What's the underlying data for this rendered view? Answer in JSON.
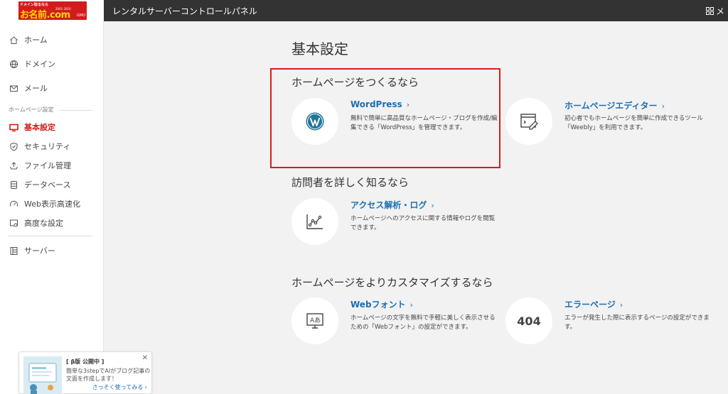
{
  "logo": {
    "tagline": "ドメイン取るなら",
    "main": "お名前.com",
    "sub": "GMO",
    "mini": "2001 2010"
  },
  "topbar": {
    "title": "レンタルサーバーコントロールパネル",
    "menu_label": "メ"
  },
  "sidebar": {
    "items": [
      {
        "label": "ホーム",
        "icon": "home-icon"
      },
      {
        "label": "ドメイン",
        "icon": "globe-icon"
      },
      {
        "label": "メール",
        "icon": "mail-icon"
      }
    ],
    "section_label": "ホームページ設定",
    "section_items": [
      {
        "label": "基本設定",
        "icon": "monitor-icon",
        "active": true
      },
      {
        "label": "セキュリティ",
        "icon": "shield-icon"
      },
      {
        "label": "ファイル管理",
        "icon": "upload-icon"
      },
      {
        "label": "データベース",
        "icon": "database-icon"
      },
      {
        "label": "Web表示高速化",
        "icon": "speed-icon"
      },
      {
        "label": "高度な設定",
        "icon": "advanced-settings-icon"
      }
    ],
    "server_item": {
      "label": "サーバー",
      "icon": "server-icon"
    }
  },
  "beta_card": {
    "title": "[ β版 公開中 ]",
    "desc": "簡単な3stepでAIがブログ記事の文面を作成します！",
    "link": "さっそく使ってみる ›",
    "close": "✕"
  },
  "main": {
    "title": "基本設定",
    "sections": [
      {
        "title": "ホームページをつくるなら",
        "cards": [
          {
            "title": "WordPress",
            "chev": "›",
            "desc": "無料で簡単に高品質なホームページ・ブログを作成/編集できる「WordPress」を管理できます。",
            "icon": "wordpress-icon"
          },
          {
            "title": "ホームページエディター",
            "chev": "›",
            "desc": "初心者でもホームページを簡単に作成できるツール「Weebly」を利用できます。",
            "icon": "page-editor-icon"
          }
        ]
      },
      {
        "title": "訪問者を詳しく知るなら",
        "cards": [
          {
            "title": "アクセス解析・ログ",
            "chev": "›",
            "desc": "ホームページへのアクセスに関する情報やログを閲覧できます。",
            "icon": "analytics-chart-icon"
          }
        ]
      },
      {
        "title": "ホームページをよりカスタマイズするなら",
        "cards": [
          {
            "title": "Webフォント",
            "chev": "›",
            "desc": "ホームページの文字を無料で手軽に美しく表示させるための「Webフォント」の設定ができます。",
            "icon": "webfont-icon"
          },
          {
            "title": "エラーページ",
            "chev": "›",
            "desc": "エラーが発生した際に表示するページの設定ができます。",
            "icon": "error-404-icon",
            "icon_text": "404"
          }
        ]
      }
    ]
  },
  "colors": {
    "accent_red": "#d31b1b",
    "link_blue": "#1a6fb5",
    "topbar_bg": "#333333",
    "highlight_border": "#e0181c"
  }
}
